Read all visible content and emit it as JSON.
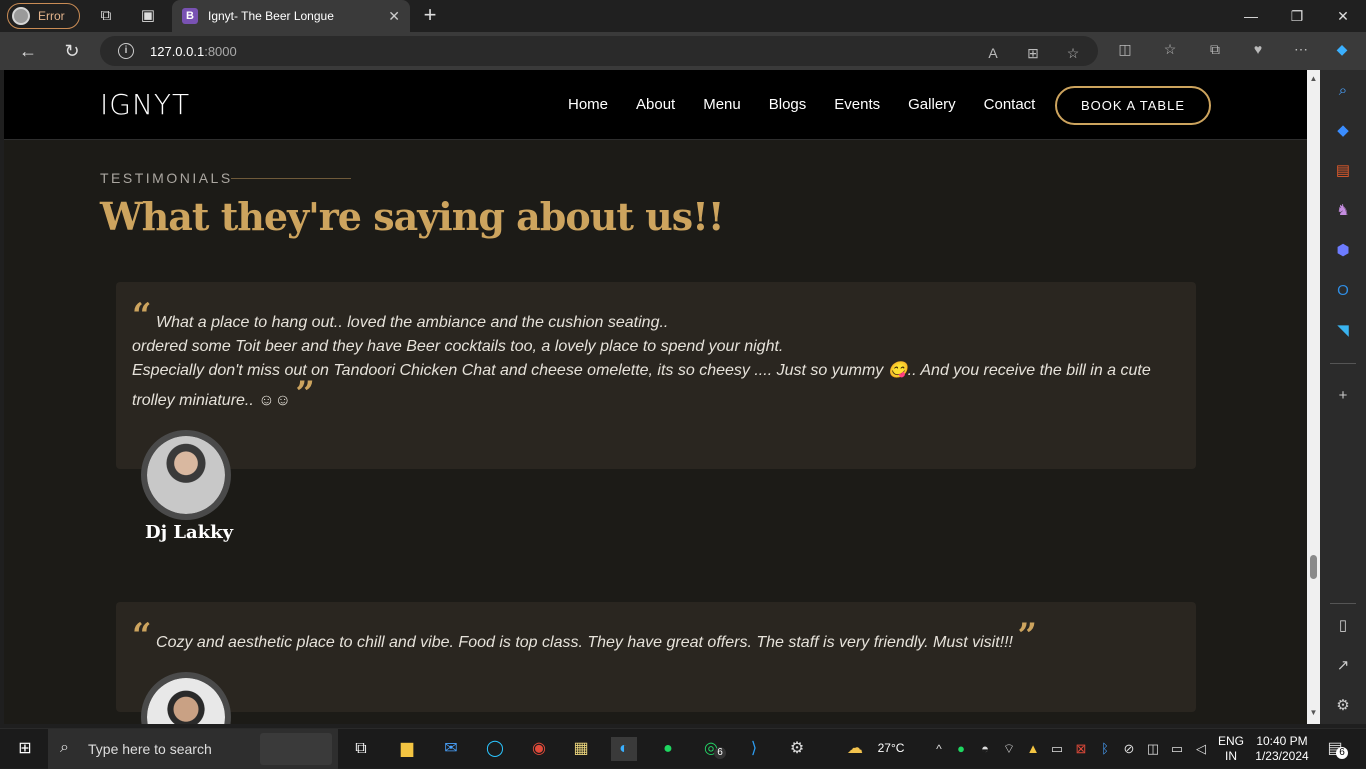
{
  "browser": {
    "profile_label": "Error",
    "tab_title": "Ignyt- The Beer Longue",
    "tab_favicon_letter": "B",
    "url_host": "127.0.0.1",
    "url_port": ":8000"
  },
  "site": {
    "logo": "IGNYT",
    "nav": [
      "Home",
      "About",
      "Menu",
      "Blogs",
      "Events",
      "Gallery",
      "Contact"
    ],
    "book_button": "BOOK A TABLE",
    "section_label": "TESTIMONIALS",
    "section_title": "What they're saying about us!!",
    "testimonials": [
      {
        "lines": [
          "What a place to hang out.. loved the ambiance and the cushion seating..",
          "ordered some Toit beer and they have Beer cocktails too, a lovely place to spend your night.",
          "Especially don't miss out on Tandoori Chicken Chat and cheese omelette, its so cheesy .... Just so yummy 😋.. And you receive the bill in a cute",
          "trolley miniature.. ☺☺"
        ],
        "author": "Dj Lakky"
      },
      {
        "lines": [
          "Cozy and aesthetic place to chill and vibe. Food is top class. They have great offers. The staff is very friendly. Must visit!!!"
        ],
        "author": ""
      }
    ]
  },
  "taskbar": {
    "search_placeholder": "Type here to search",
    "weather": "27°C",
    "lang_top": "ENG",
    "lang_bottom": "IN",
    "time": "10:40 PM",
    "date": "1/23/2024",
    "whatsapp_badge": "6",
    "notification_badge": "6"
  },
  "colors": {
    "accent": "#cda45e",
    "page_bg": "#1c1b17",
    "card_bg": "#2a2620"
  }
}
